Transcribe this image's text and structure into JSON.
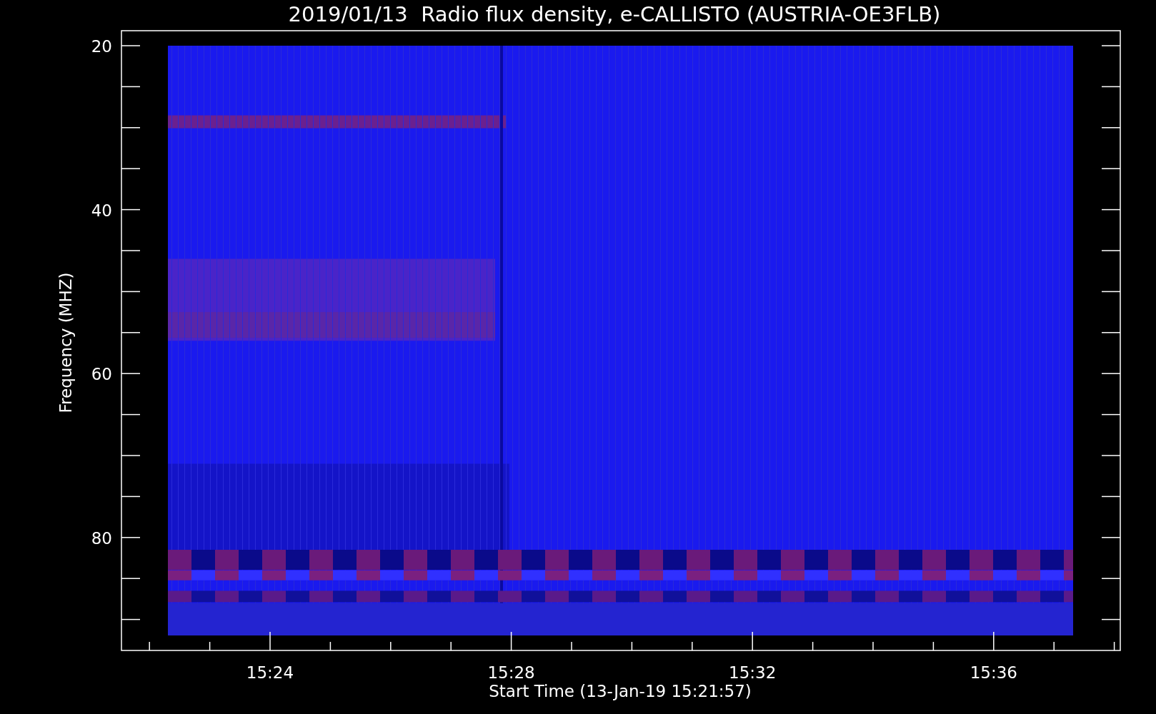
{
  "title": "2019/01/13  Radio flux density, e-CALLISTO (AUSTRIA-OE3FLB)",
  "y_axis": {
    "label": "Frequency (MHZ)",
    "ticks": [
      "20",
      "40",
      "60",
      "80"
    ]
  },
  "x_axis": {
    "label": "Start Time (13-Jan-19 15:21:57)",
    "ticks": [
      "15:24",
      "15:28",
      "15:32",
      "15:36"
    ]
  }
}
